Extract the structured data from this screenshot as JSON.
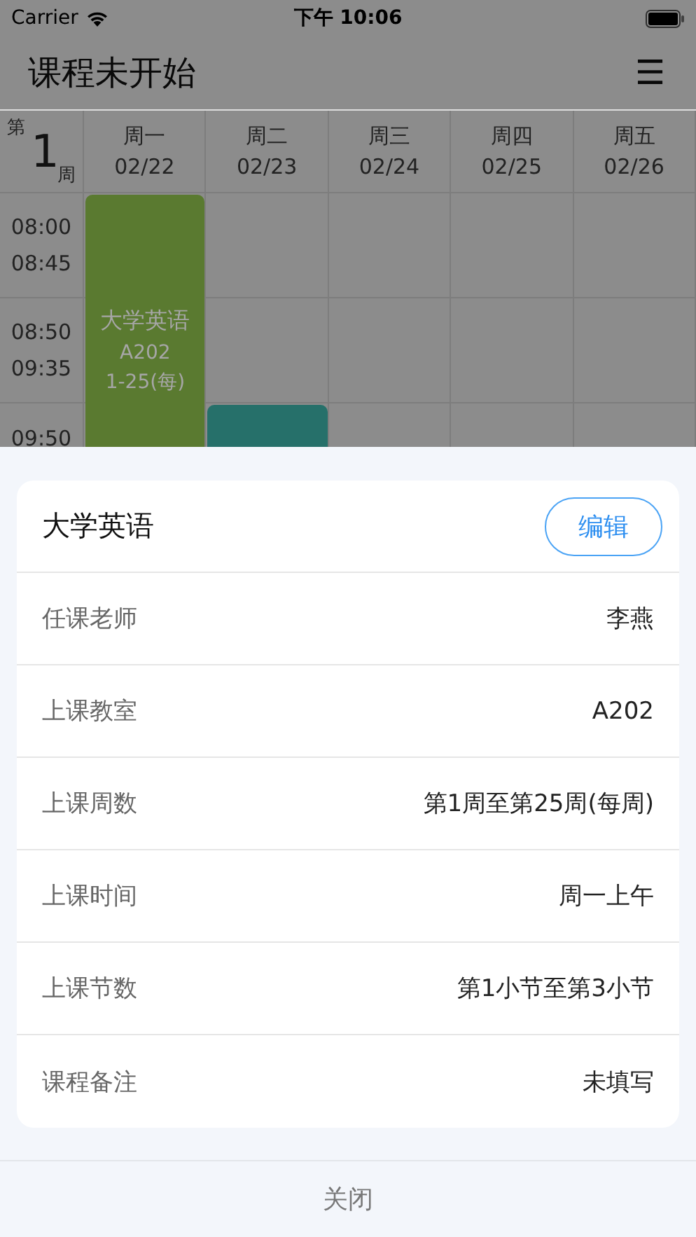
{
  "status_bar": {
    "carrier": "Carrier",
    "time": "下午 10:06"
  },
  "header": {
    "title": "课程未开始",
    "menu_icon": "☰"
  },
  "timetable": {
    "week": {
      "prefix": "第",
      "number": "1",
      "suffix": "周"
    },
    "days": [
      {
        "name": "周一",
        "date": "02/22"
      },
      {
        "name": "周二",
        "date": "02/23"
      },
      {
        "name": "周三",
        "date": "02/24"
      },
      {
        "name": "周四",
        "date": "02/25"
      },
      {
        "name": "周五",
        "date": "02/26"
      }
    ],
    "slots": [
      {
        "start": "08:00",
        "end": "08:45"
      },
      {
        "start": "08:50",
        "end": "09:35"
      },
      {
        "start": "09:50"
      }
    ],
    "courses": [
      {
        "name": "大学英语",
        "room": "A202",
        "weeks": "1-25(每)",
        "color": "#5a7a30"
      },
      {
        "color": "#26706a"
      }
    ]
  },
  "detail_sheet": {
    "title": "大学英语",
    "edit_button": "编辑",
    "rows": [
      {
        "label": "任课老师",
        "value": "李燕"
      },
      {
        "label": "上课教室",
        "value": "A202"
      },
      {
        "label": "上课周数",
        "value": "第1周至第25周(每周)"
      },
      {
        "label": "上课时间",
        "value": "周一上午"
      },
      {
        "label": "上课节数",
        "value": "第1小节至第3小节"
      },
      {
        "label": "课程备注",
        "value": "未填写"
      }
    ],
    "close_button": "关闭"
  }
}
